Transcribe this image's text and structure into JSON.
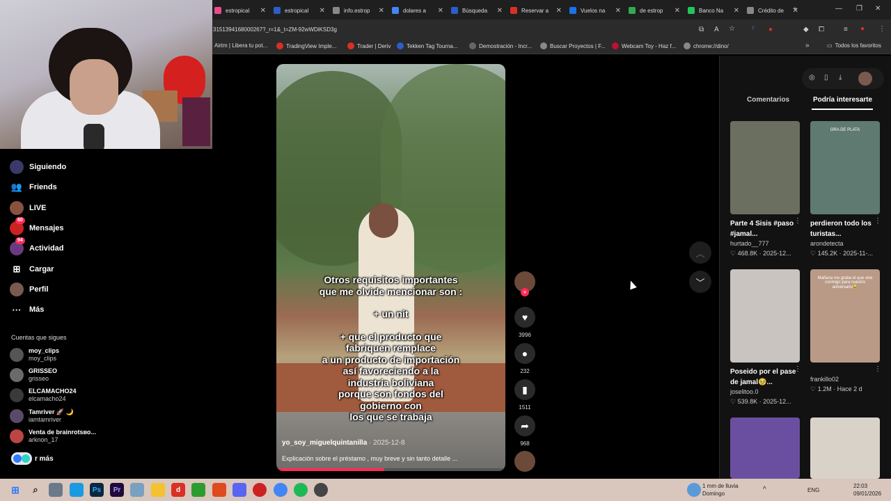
{
  "browser": {
    "tabs": [
      {
        "title": "estropical",
        "color": "#e74b8b"
      },
      {
        "title": "estropical",
        "color": "#2b5ec7"
      },
      {
        "title": "info.estrop",
        "color": "#888888"
      },
      {
        "title": "dolares a",
        "color": "#4285f4"
      },
      {
        "title": "Búsqueda",
        "color": "#2b5ec7"
      },
      {
        "title": "Reservar a",
        "color": "#d93025"
      },
      {
        "title": "Vuelos na",
        "color": "#1a73e8"
      },
      {
        "title": "de estrop",
        "color": "#34a853"
      },
      {
        "title": "Banco Na",
        "color": "#22c55e"
      },
      {
        "title": "Crédito de",
        "color": "#888888"
      }
    ],
    "url": "3151394168000267?_r=1&_t=ZM-92wWDiKSD3g",
    "bookmarks": [
      {
        "label": "Airtm | Libera tu pot...",
        "color": "#444444"
      },
      {
        "label": "TradingView Imple...",
        "color": "#d93025"
      },
      {
        "label": "Trader | Deriv",
        "color": "#d93025"
      },
      {
        "label": "Tekken Tag Tourna...",
        "color": "#2b5ec7"
      },
      {
        "label": "Demostración - Incr...",
        "color": "#666666"
      },
      {
        "label": "Buscar Proyectos | F...",
        "color": "#888888"
      },
      {
        "label": "Webcam Toy - Haz f...",
        "color": "#bb1133"
      },
      {
        "label": "chrome://dino/",
        "color": "#888888"
      }
    ],
    "all_favorites": "Todos los favoritos"
  },
  "sidebar": {
    "items": [
      {
        "label": "Siguiendo",
        "icon": "following-icon"
      },
      {
        "label": "Friends",
        "icon": "friends-icon"
      },
      {
        "label": "LIVE",
        "icon": "live-icon"
      },
      {
        "label": "Mensajes",
        "icon": "messages-icon",
        "badge": "60"
      },
      {
        "label": "Actividad",
        "icon": "activity-icon",
        "badge": "94"
      },
      {
        "label": "Cargar",
        "icon": "upload-icon"
      },
      {
        "label": "Perfil",
        "icon": "profile-icon"
      },
      {
        "label": "Más",
        "icon": "more-icon"
      }
    ],
    "following_title": "Cuentas que sigues",
    "accounts": [
      {
        "name": "moy_clips",
        "handle": "moy_clips"
      },
      {
        "name": "GRISSEO",
        "handle": "grisseo"
      },
      {
        "name": "ELCAMACHO24",
        "handle": "elcamacho24"
      },
      {
        "name": "Tamriver 🚀 🌙",
        "handle": "iamtamriver"
      },
      {
        "name": "Venta de brainrotsво...",
        "handle": "arknon_17"
      }
    ],
    "see_more": "r más"
  },
  "video": {
    "overlay_lines": [
      "Otros requisitos importantes",
      "que me olvide mencionar son :",
      "",
      "+ un nit",
      "",
      "+ que el producto que",
      "fabriquen remplace",
      "a un producto de importación",
      "así favoreciendo a la",
      "industria boliviana",
      "porque son fondos del",
      "gobierno con",
      "los que se trabaja"
    ],
    "author": "yo_soy_miguelquintanilla",
    "date": " · 2025-12-8",
    "description": "Explicación sobre el préstamo , muy breve y sin tanto detalle ...",
    "progress": 0.47
  },
  "actions": {
    "likes": "3996",
    "comments": "232",
    "saves": "1511",
    "shares": "968"
  },
  "right_panel": {
    "tabs": [
      "Comentarios",
      "Podría interesarte"
    ],
    "cards": [
      {
        "title": "Parte 4 Sisis #paso #jamal...",
        "author": "hurtado__777",
        "likes": "468.8K",
        "date": "2025-12...",
        "thumb_color": "#6b6f5f"
      },
      {
        "title": "perdieron todo los turistas...",
        "author": "arondetecta",
        "likes": "145.2K",
        "date": "2025-11-...",
        "thumb_color": "#5f7a70",
        "thumb_text": "ORA DE PLATA"
      },
      {
        "title": "Poseido por el pase de jamal🥹...",
        "author": "joselitoo.0",
        "likes": "539.8K",
        "date": "2025-12...",
        "thumb_color": "#c9c4c0"
      },
      {
        "title": "",
        "author": "frankillo02",
        "likes": "1.2M",
        "date": "Hace 2 d",
        "thumb_color": "#b89a86",
        "thumb_text": "Mañana me graba el que vive conmigo para nuestro aniversario😂"
      },
      {
        "title": "",
        "author": "",
        "likes": "",
        "date": "",
        "thumb_color": "#6a4fa0"
      },
      {
        "title": "",
        "author": "",
        "likes": "",
        "date": "",
        "thumb_color": "#d8d2c8"
      }
    ]
  },
  "taskbar": {
    "weather_line1": "1 mm de lluvia",
    "weather_line2": "Domingo",
    "lang": "ENG",
    "time": "22:03",
    "date": "09/01/2026"
  }
}
